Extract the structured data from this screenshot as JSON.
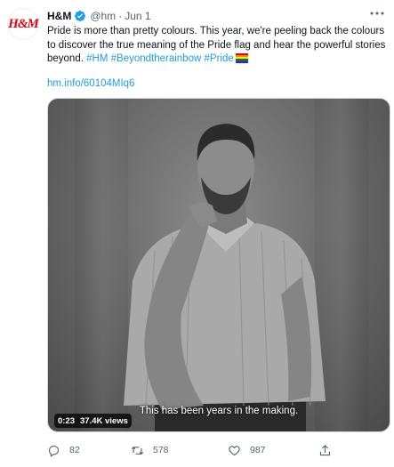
{
  "tweet": {
    "author_name": "H&M",
    "handle": "@hm",
    "separator": "·",
    "date": "Jun 1",
    "avatar_logo_text": "H&M",
    "text_part": "Pride is more than pretty colours. This year, we're peeling back the colours to discover the true meaning of the Pride flag and hear the powerful stories beyond.",
    "hashtags": [
      "#HM",
      "#Beyondtherainbow",
      "#Pride"
    ],
    "short_link": "hm.info/60104MIq6"
  },
  "media": {
    "subtitle": "This has been years in the making.",
    "duration": "0:23",
    "views": "37.4K views"
  },
  "actions": {
    "replies": "82",
    "retweets": "578",
    "likes": "987"
  },
  "icons": {
    "verified": "verified-badge-icon",
    "more": "more-options-icon",
    "reply": "reply-icon",
    "retweet": "retweet-icon",
    "like": "heart-icon",
    "share": "share-icon",
    "flag": "rainbow-flag-emoji"
  },
  "colors": {
    "link": "#1d9bf0",
    "secondary_text": "#536471",
    "brand_red": "#e50010"
  }
}
